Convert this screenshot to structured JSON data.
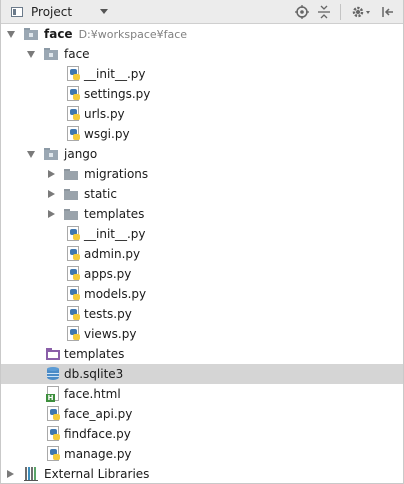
{
  "toolbar": {
    "view_label": "Project",
    "icons": [
      "sync-icon",
      "collapse-all-icon",
      "gear-icon",
      "hide-panel-icon"
    ]
  },
  "tree": {
    "root_name": "face",
    "root_path": "D:¥workspace¥face",
    "face_pkg": "face",
    "face_init": "__init__.py",
    "face_settings": "settings.py",
    "face_urls": "urls.py",
    "face_wsgi": "wsgi.py",
    "jango_pkg": "jango",
    "jango_migrations": "migrations",
    "jango_static": "static",
    "jango_templates": "templates",
    "jango_init": "__init__.py",
    "jango_admin": "admin.py",
    "jango_apps": "apps.py",
    "jango_models": "models.py",
    "jango_tests": "tests.py",
    "jango_views": "views.py",
    "templates": "templates",
    "db": "db.sqlite3",
    "face_html": "face.html",
    "face_api": "face_api.py",
    "findface": "findface.py",
    "manage": "manage.py",
    "external_libraries": "External Libraries"
  },
  "colors": {
    "selection": "#d5d5d5",
    "toolbar_bg": "#ececec"
  }
}
